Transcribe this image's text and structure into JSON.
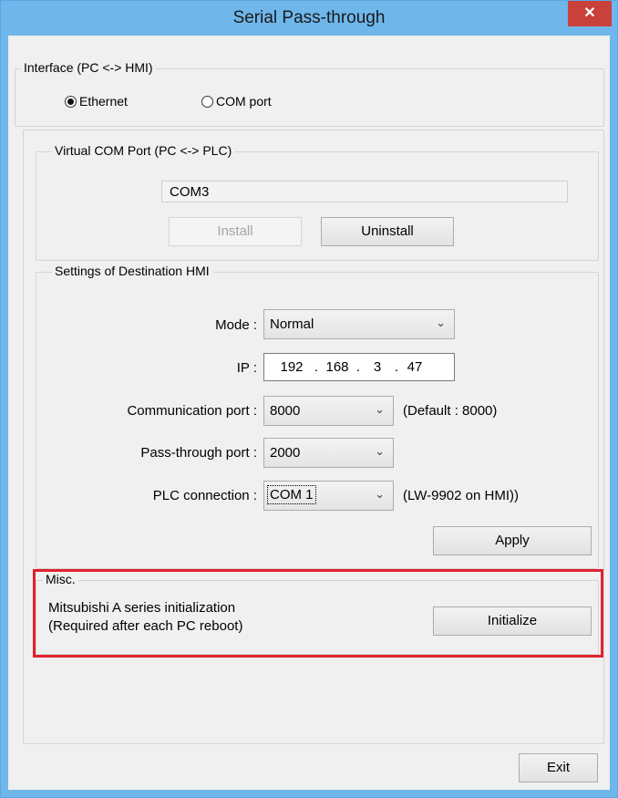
{
  "window": {
    "title": "Serial Pass-through",
    "close_glyph": "✕"
  },
  "interface_group": {
    "label": "Interface (PC <-> HMI)",
    "options": [
      {
        "label": "Ethernet",
        "selected": true
      },
      {
        "label": "COM port",
        "selected": false
      }
    ]
  },
  "virtual_com": {
    "label": "Virtual COM Port (PC <-> PLC)",
    "value": "COM3",
    "install_label": "Install",
    "uninstall_label": "Uninstall"
  },
  "settings": {
    "label": "Settings of Destination HMI",
    "mode_label": "Mode :",
    "mode_value": "Normal",
    "ip_label": "IP :",
    "ip": [
      "192",
      "168",
      "3",
      "47"
    ],
    "ip_sep": ".",
    "comm_port_label": "Communication port :",
    "comm_port_value": "8000",
    "comm_port_note": "(Default : 8000)",
    "pass_port_label": "Pass-through port :",
    "pass_port_value": "2000",
    "plc_label": "PLC connection :",
    "plc_value": "COM 1",
    "plc_note": "(LW-9902 on HMI))",
    "apply_label": "Apply"
  },
  "misc": {
    "label": "Misc.",
    "line1": "Mitsubishi A series initialization",
    "line2": "(Required after each PC reboot)",
    "initialize_label": "Initialize",
    "highlight_color": "#e0232e"
  },
  "exit_label": "Exit",
  "icons": {
    "dropdown": "chevron-down-icon",
    "close": "close-icon"
  }
}
